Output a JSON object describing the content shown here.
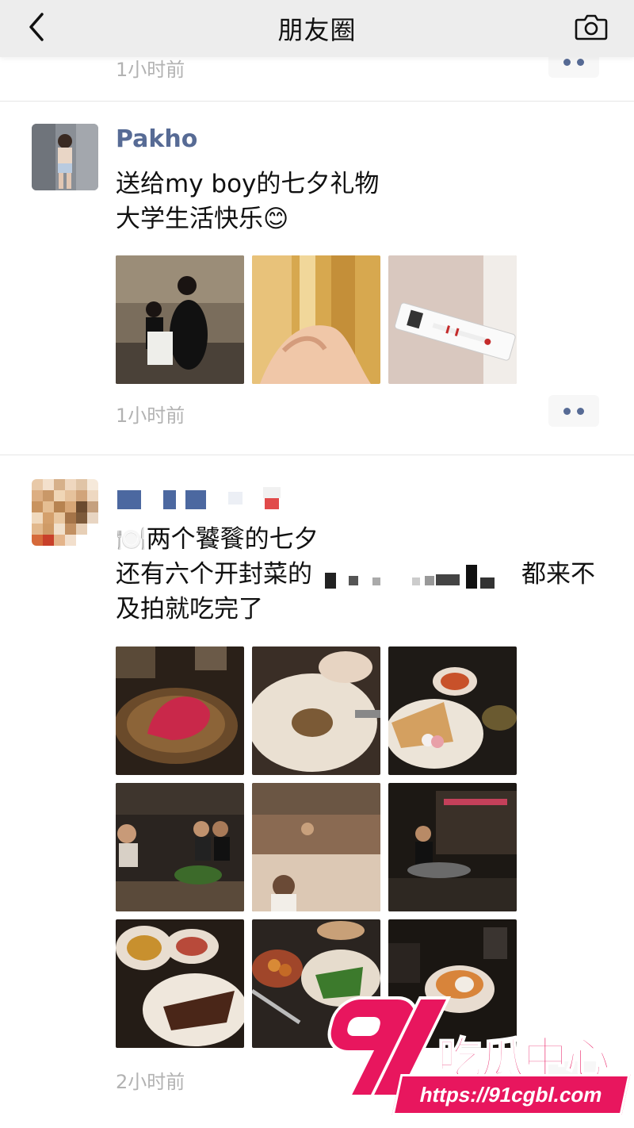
{
  "nav": {
    "title": "朋友圈"
  },
  "prev_post": {
    "time": "1小时前"
  },
  "posts": [
    {
      "author": "Pakho",
      "text": "送给my boy的七夕礼物\n大学生活快乐😊",
      "time": "1小时前"
    },
    {
      "author": "",
      "text_line1": "🍽️两个饕餮的七夕",
      "text_line2a": "还有六个开封菜的",
      "text_line2b": "都来不",
      "text_line3": "及拍就吃完了",
      "time": "2小时前"
    }
  ],
  "watermark": {
    "brand": "吃瓜中心",
    "url": "https://91cgbl.com"
  },
  "colors": {
    "link": "#576b95",
    "accent": "#e8165e",
    "time": "#b2b2b2",
    "nav_bg": "#ededed"
  },
  "icons": [
    "back-chevron-icon",
    "camera-icon",
    "more-dots-icon"
  ]
}
